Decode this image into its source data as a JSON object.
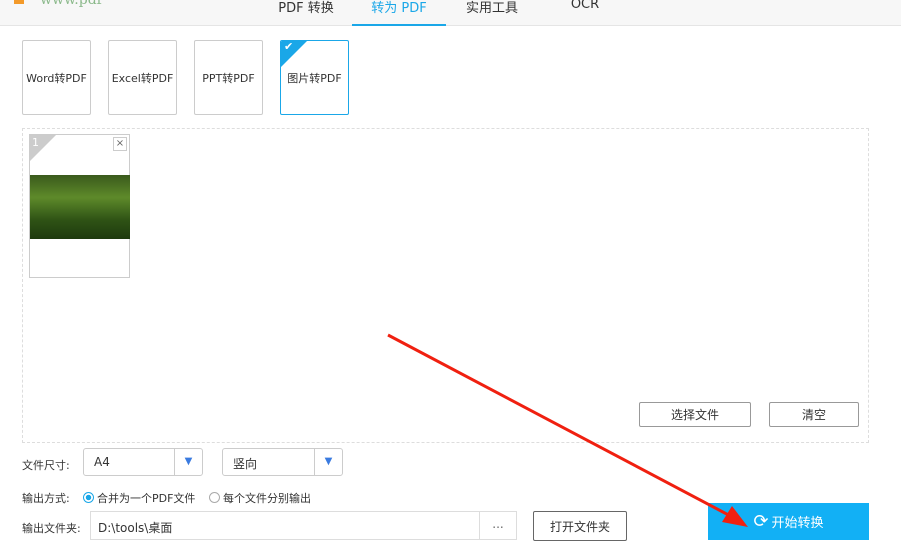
{
  "header": {
    "tabs": [
      {
        "label": "PDF 转换"
      },
      {
        "label": "转为 PDF"
      },
      {
        "label": "实用工具"
      },
      {
        "label": "OCR"
      }
    ],
    "active_tab": "转为 PDF"
  },
  "modes": [
    {
      "label": "Word转PDF"
    },
    {
      "label": "Excel转PDF"
    },
    {
      "label": "PPT转PDF"
    },
    {
      "label": "图片转PDF"
    }
  ],
  "file_list": {
    "items": [
      {
        "index": "1",
        "remove": "×"
      }
    ],
    "select_button": "选择文件",
    "clear_button": "清空"
  },
  "settings": {
    "size_label": "文件尺寸:",
    "size_value": "A4",
    "orientation_value": "竖向",
    "output_mode_label": "输出方式:",
    "mode_merge": "合并为一个PDF文件",
    "mode_separate": "每个文件分别输出",
    "folder_label": "输出文件夹:",
    "folder_value": "D:\\tools\\桌面",
    "browse": "...",
    "open_folder": "打开文件夹",
    "start": "开始转换"
  },
  "colors": {
    "accent": "#1aa7e8",
    "start_button": "#12b0f5",
    "arrow": "#f02010"
  }
}
